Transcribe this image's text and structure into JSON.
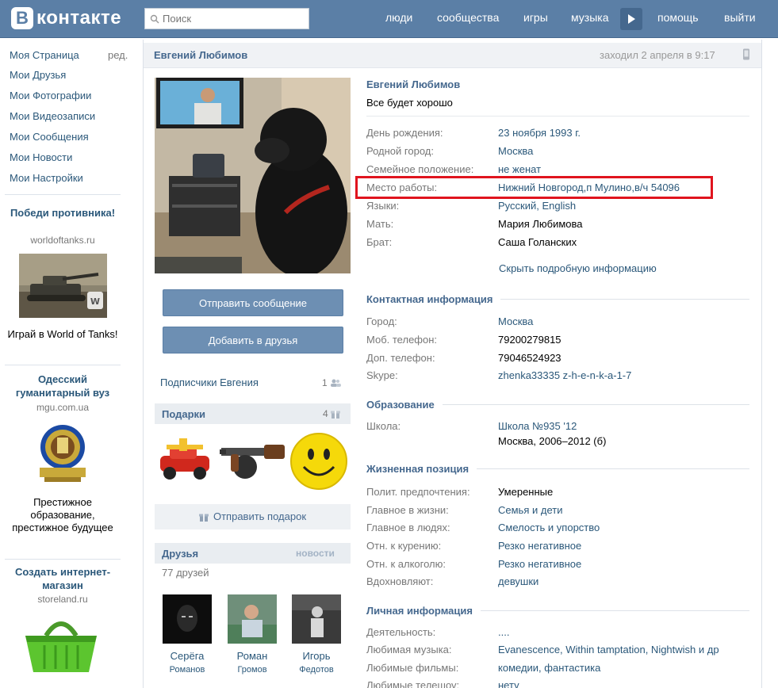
{
  "header": {
    "logo_letter": "В",
    "logo_text": "контакте",
    "search_placeholder": "Поиск",
    "nav": [
      "люди",
      "сообщества",
      "игры",
      "музыка",
      "помощь",
      "выйти"
    ]
  },
  "left_menu": {
    "items": [
      "Моя Страница",
      "Мои Друзья",
      "Мои Фотографии",
      "Мои Видеозаписи",
      "Мои Сообщения",
      "Мои Новости",
      "Мои Настройки"
    ],
    "edit_label": "ред."
  },
  "ads": [
    {
      "title": "Победи противника!",
      "domain": "worldoftanks.ru",
      "text": "Играй в World of Tanks!"
    },
    {
      "title": "Одесский гуманитарный вуз",
      "domain": "mgu.com.ua",
      "text": "Престижное образование, престижное будущее"
    },
    {
      "title": "Создать интернет-магазин",
      "domain": "storeland.ru"
    }
  ],
  "profile": {
    "header_name": "Евгений Любимов",
    "last_seen": "заходил 2 апреля в 9:17",
    "send_message": "Отправить сообщение",
    "add_friend": "Добавить в друзья",
    "subscribers_label": "Подписчики Евгения",
    "subscribers_count": "1",
    "gifts_title": "Подарки",
    "gifts_count": "4",
    "send_gift": "Отправить подарок",
    "friends_title": "Друзья",
    "friends_news": "новости",
    "friends_count": "77 друзей",
    "friends": [
      {
        "first": "Серёга",
        "last": "Романов"
      },
      {
        "first": "Роман",
        "last": "Громов"
      },
      {
        "first": "Игорь",
        "last": "Федотов"
      }
    ]
  },
  "info": {
    "name": "Евгений Любимов",
    "status": "Все будет хорошо",
    "main_rows": [
      {
        "label": "День рождения:",
        "value": "23 ноября 1993 г."
      },
      {
        "label": "Родной город:",
        "value": "Москва"
      },
      {
        "label": "Семейное положение:",
        "value": "не женат"
      },
      {
        "label": "Место работы:",
        "value": "Нижний Новгород,п Мулино,в/ч 54096"
      },
      {
        "label": "Языки:",
        "value": "Русский, English"
      },
      {
        "label": "Мать:",
        "value": "Мария Любимова"
      },
      {
        "label": "Брат:",
        "value": "Саша Голанских"
      }
    ],
    "hide_details": "Скрыть подробную информацию",
    "contact_title": "Контактная информация",
    "contact_rows": [
      {
        "label": "Город:",
        "value": "Москва"
      },
      {
        "label": "Моб. телефон:",
        "value": "79200279815"
      },
      {
        "label": "Доп. телефон:",
        "value": "79046524923"
      },
      {
        "label": "Skype:",
        "value": "zhenka33335 z-h-e-n-k-a-1-7"
      }
    ],
    "education_title": "Образование",
    "education_label": "Школа:",
    "education_school": "Школа №935 '12",
    "education_detail": "Москва, 2006–2012 (б)",
    "life_title": "Жизненная позиция",
    "life_rows": [
      {
        "label": "Полит. предпочтения:",
        "value": "Умеренные"
      },
      {
        "label": "Главное в жизни:",
        "value": "Семья и дети"
      },
      {
        "label": "Главное в людях:",
        "value": "Смелость и упорство"
      },
      {
        "label": "Отн. к курению:",
        "value": "Резко негативное"
      },
      {
        "label": "Отн. к алкоголю:",
        "value": "Резко негативное"
      },
      {
        "label": "Вдохновляют:",
        "value": "девушки"
      }
    ],
    "personal_title": "Личная информация",
    "personal_rows": [
      {
        "label": "Деятельность:",
        "value": "...."
      },
      {
        "label": "Любимая музыка:",
        "value": "Evanescence, Within tamptation, Nightwish и др"
      },
      {
        "label": "Любимые фильмы:",
        "value": "комедии, фантастика"
      },
      {
        "label": "Любимые телешоу:",
        "value": "нету"
      }
    ]
  }
}
